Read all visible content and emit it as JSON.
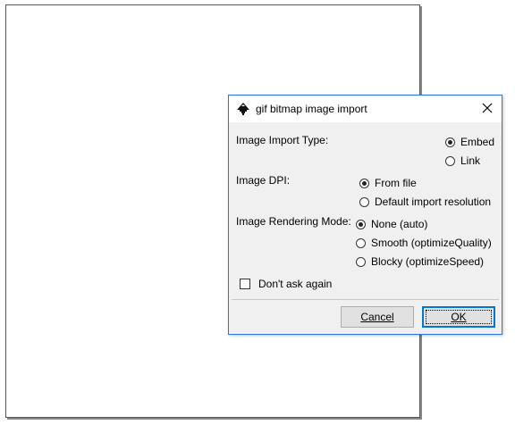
{
  "dialog": {
    "title": "gif bitmap image import",
    "import_type": {
      "label": "Image Import Type:",
      "options": [
        {
          "label": "Embed",
          "checked": true
        },
        {
          "label": "Link",
          "checked": false
        }
      ]
    },
    "dpi": {
      "label": "Image DPI:",
      "options": [
        {
          "label": "From file",
          "checked": true
        },
        {
          "label": "Default import resolution",
          "checked": false
        }
      ]
    },
    "rendering": {
      "label": "Image Rendering Mode:",
      "options": [
        {
          "label": "None (auto)",
          "checked": true
        },
        {
          "label": "Smooth (optimizeQuality)",
          "checked": false
        },
        {
          "label": "Blocky (optimizeSpeed)",
          "checked": false
        }
      ]
    },
    "dont_ask_label": "Don't ask again",
    "cancel_label": "Cancel",
    "ok_label": "OK"
  },
  "icons": {
    "app": "inkscape-icon",
    "close": "close-icon"
  },
  "colors": {
    "dialog_border": "#2b78d6",
    "dialog_bg": "#f0f0f0",
    "default_button_border": "#0078d7"
  }
}
